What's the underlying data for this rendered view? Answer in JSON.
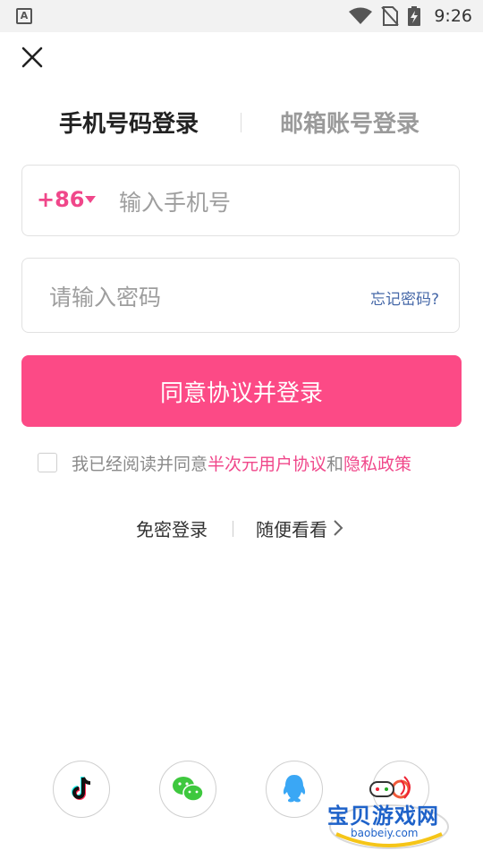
{
  "status_bar": {
    "time": "9:26",
    "icons": [
      "a-notification-icon",
      "wifi-icon",
      "no-sim-icon",
      "battery-charging-icon"
    ]
  },
  "tabs": {
    "phone_login": "手机号码登录",
    "email_login": "邮箱账号登录"
  },
  "phone_field": {
    "country_code": "+86",
    "placeholder": "输入手机号",
    "value": ""
  },
  "password_field": {
    "placeholder": "请输入密码",
    "value": "",
    "forgot_link": "忘记密码?"
  },
  "login_button": "同意协议并登录",
  "agreement": {
    "checked": false,
    "prefix": "我已经阅读并同意",
    "user_agreement": "半次元用户协议",
    "and": "和",
    "privacy_policy": "隐私政策"
  },
  "alt_options": {
    "free_login": "免密登录",
    "browse": "随便看看"
  },
  "social_logins": [
    "tiktok-icon",
    "wechat-icon",
    "qq-icon",
    "extra-icon"
  ],
  "watermark": {
    "title": "宝贝游戏网",
    "url": "baobeiy.com"
  },
  "colors": {
    "accent": "#fc4a86",
    "link_pink": "#f0478a",
    "link_blue": "#4668a8"
  }
}
